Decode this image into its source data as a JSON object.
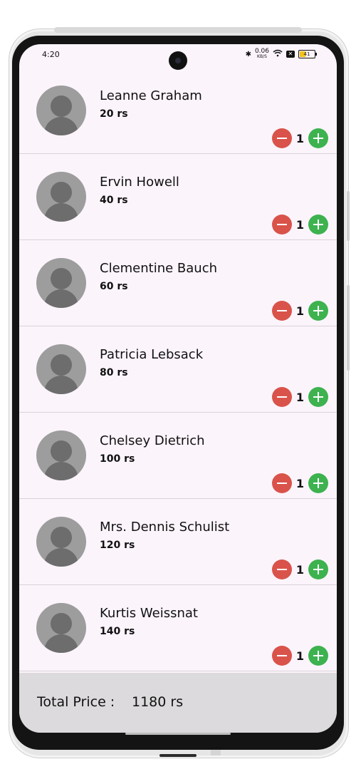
{
  "status_bar": {
    "time": "4:20",
    "net_speed": "0.06",
    "net_unit": "KB/S",
    "battery_level": "41"
  },
  "items": [
    {
      "name": "Leanne Graham",
      "price": "20 rs",
      "qty": "1"
    },
    {
      "name": "Ervin Howell",
      "price": "40 rs",
      "qty": "1"
    },
    {
      "name": "Clementine Bauch",
      "price": "60 rs",
      "qty": "1"
    },
    {
      "name": "Patricia Lebsack",
      "price": "80 rs",
      "qty": "1"
    },
    {
      "name": "Chelsey Dietrich",
      "price": "100 rs",
      "qty": "1"
    },
    {
      "name": "Mrs. Dennis Schulist",
      "price": "120 rs",
      "qty": "1"
    },
    {
      "name": "Kurtis Weissnat",
      "price": "140 rs",
      "qty": "1"
    }
  ],
  "footer": {
    "label": "Total Price :",
    "total": "1180 rs"
  },
  "colors": {
    "minus": "#d9534a",
    "plus": "#3db24f",
    "screen_bg": "#fbf4fb",
    "footer_bg": "#dcdadc"
  },
  "icons": [
    "avatar-placeholder-icon",
    "minus-circle-icon",
    "plus-circle-icon",
    "bluetooth-icon",
    "wifi-icon",
    "battery-icon"
  ]
}
